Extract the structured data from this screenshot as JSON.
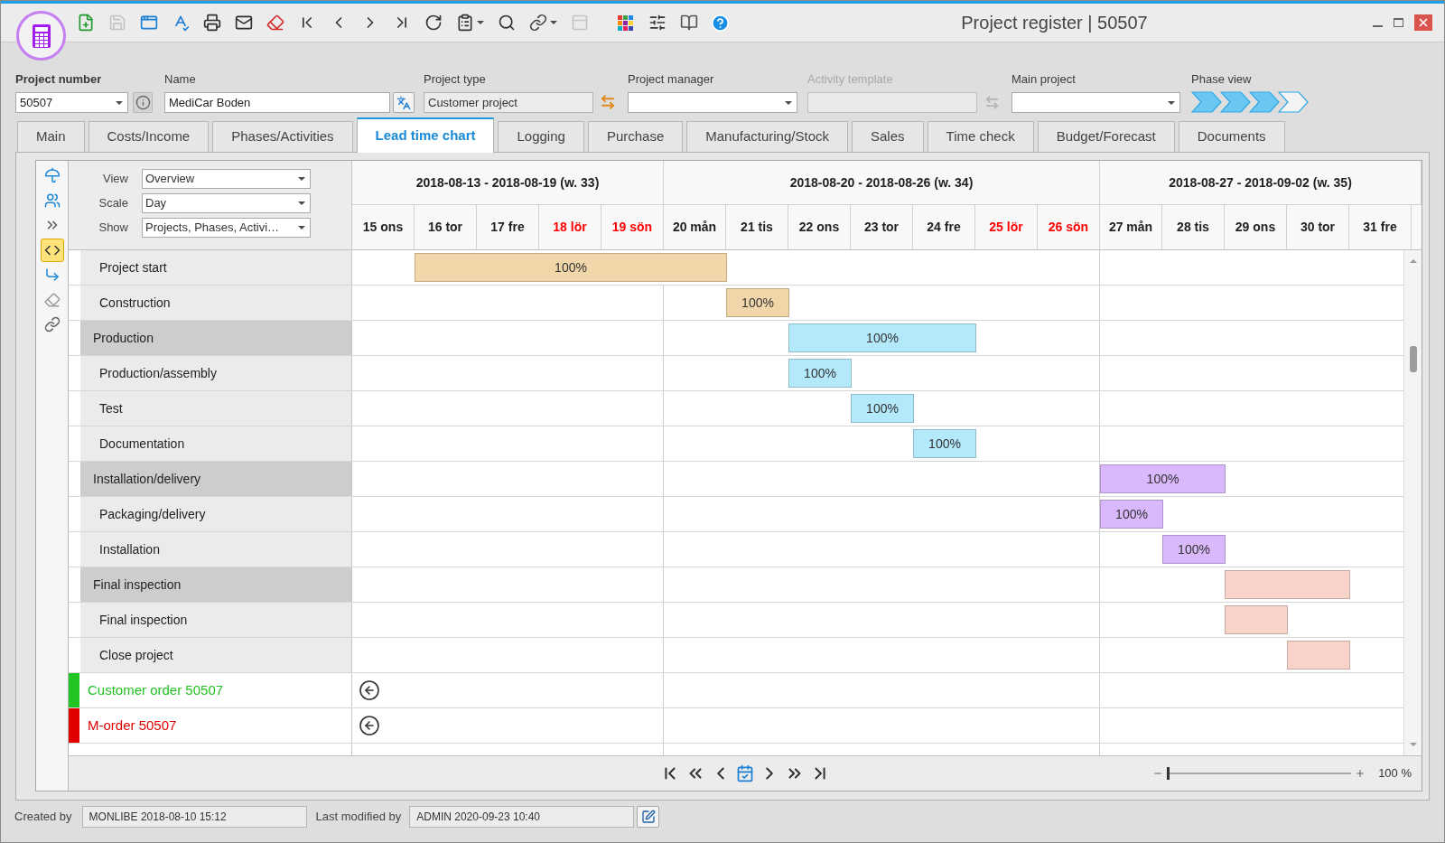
{
  "window": {
    "title": "Project register | 50507"
  },
  "toolbar": [
    {
      "kind": "new",
      "disabled": false,
      "dropdown": false
    },
    {
      "kind": "save",
      "disabled": true,
      "dropdown": false
    },
    {
      "kind": "window",
      "disabled": false,
      "dropdown": false
    },
    {
      "kind": "spell",
      "disabled": false,
      "dropdown": false
    },
    {
      "kind": "print",
      "disabled": false,
      "dropdown": false
    },
    {
      "kind": "mail",
      "disabled": false,
      "dropdown": false
    },
    {
      "kind": "eraser",
      "disabled": false,
      "dropdown": false
    },
    {
      "kind": "first",
      "disabled": false,
      "dropdown": false
    },
    {
      "kind": "prev",
      "disabled": false,
      "dropdown": false
    },
    {
      "kind": "next",
      "disabled": false,
      "dropdown": false
    },
    {
      "kind": "last",
      "disabled": false,
      "dropdown": false
    },
    {
      "kind": "refresh",
      "disabled": false,
      "dropdown": false
    },
    {
      "kind": "clipboard",
      "disabled": false,
      "dropdown": true
    },
    {
      "kind": "search",
      "disabled": false,
      "dropdown": false
    },
    {
      "kind": "link",
      "disabled": false,
      "dropdown": true
    },
    {
      "kind": "panel",
      "disabled": true,
      "dropdown": false
    },
    {
      "kind": "grid",
      "disabled": false,
      "dropdown": false
    },
    {
      "kind": "sliders",
      "disabled": false,
      "dropdown": false
    },
    {
      "kind": "book",
      "disabled": false,
      "dropdown": false
    },
    {
      "kind": "help",
      "disabled": false,
      "dropdown": false
    }
  ],
  "header_fields": {
    "project_number": {
      "label": "Project number",
      "value": "50507"
    },
    "name": {
      "label": "Name",
      "value": "MediCar Boden"
    },
    "project_type": {
      "label": "Project type",
      "value": "Customer project",
      "readonly": true
    },
    "project_manager": {
      "label": "Project manager"
    },
    "activity_template": {
      "label": "Activity template",
      "disabled": true
    },
    "main_project": {
      "label": "Main project"
    },
    "phase_view": {
      "label": "Phase view",
      "phases": [
        {
          "done": true
        },
        {
          "done": true
        },
        {
          "done": true
        },
        {
          "done": false
        }
      ]
    }
  },
  "tabs": [
    {
      "label": "Main",
      "selected": false
    },
    {
      "label": "Costs/Income",
      "selected": false
    },
    {
      "label": "Phases/Activities",
      "selected": false
    },
    {
      "label": "Lead time chart",
      "selected": true
    },
    {
      "label": "Logging",
      "selected": false
    },
    {
      "label": "Purchase",
      "selected": false
    },
    {
      "label": "Manufacturing/Stock",
      "selected": false
    },
    {
      "label": "Sales",
      "selected": false
    },
    {
      "label": "Time check",
      "selected": false
    },
    {
      "label": "Budget/Forecast",
      "selected": false
    },
    {
      "label": "Documents",
      "selected": false
    }
  ],
  "side_tools": [
    {
      "kind": "umbrella",
      "selected": false
    },
    {
      "kind": "people",
      "selected": false
    },
    {
      "kind": "arrows",
      "selected": false
    },
    {
      "kind": "code",
      "selected": true
    },
    {
      "kind": "connector",
      "selected": false
    },
    {
      "kind": "eraser",
      "selected": false
    },
    {
      "kind": "link",
      "selected": false
    }
  ],
  "chart_options": [
    {
      "label": "View",
      "value": "Overview"
    },
    {
      "label": "Scale",
      "value": "Day"
    },
    {
      "label": "Show",
      "value": "Projects, Phases, Activi…"
    }
  ],
  "weeks": [
    {
      "label": "2018-08-13 - 2018-08-19 (w. 33)",
      "days": [
        {
          "label": "15 ons",
          "weekend": false
        },
        {
          "label": "16 tor",
          "weekend": false
        },
        {
          "label": "17 fre",
          "weekend": false
        },
        {
          "label": "18 lör",
          "weekend": true
        },
        {
          "label": "19 sön",
          "weekend": true
        }
      ]
    },
    {
      "label": "2018-08-20 - 2018-08-26 (w. 34)",
      "days": [
        {
          "label": "20 mån",
          "weekend": false
        },
        {
          "label": "21 tis",
          "weekend": false
        },
        {
          "label": "22 ons",
          "weekend": false
        },
        {
          "label": "23 tor",
          "weekend": false
        },
        {
          "label": "24 fre",
          "weekend": false
        },
        {
          "label": "25 lör",
          "weekend": true
        },
        {
          "label": "26 sön",
          "weekend": true
        }
      ]
    },
    {
      "label": "2018-08-27 - 2018-09-02 (w. 35)",
      "days": [
        {
          "label": "27 mån",
          "weekend": false
        },
        {
          "label": "28 tis",
          "weekend": false
        },
        {
          "label": "29 ons",
          "weekend": false
        },
        {
          "label": "30 tor",
          "weekend": false
        },
        {
          "label": "31 fre",
          "weekend": false
        }
      ]
    }
  ],
  "rows": [
    {
      "kind": "activity",
      "label": "Project start",
      "color": "#f1d6a9",
      "bar_label": "100%",
      "scheduled": [
        false,
        true,
        true,
        true,
        true,
        true,
        false,
        false,
        false,
        false,
        false,
        false,
        false,
        false,
        false,
        false,
        false
      ]
    },
    {
      "kind": "activity",
      "label": "Construction",
      "color": "#f1d6a9",
      "bar_label": "100%",
      "scheduled": [
        false,
        false,
        false,
        false,
        false,
        false,
        true,
        false,
        false,
        false,
        false,
        false,
        false,
        false,
        false,
        false,
        false
      ]
    },
    {
      "kind": "phase",
      "label": "Production",
      "color": "#b3e9fb",
      "bar_label": "100%",
      "scheduled": [
        false,
        false,
        false,
        false,
        false,
        false,
        false,
        true,
        true,
        true,
        false,
        false,
        false,
        false,
        false,
        false,
        false
      ]
    },
    {
      "kind": "activity",
      "label": "Production/assembly",
      "color": "#b3e9fb",
      "bar_label": "100%",
      "scheduled": [
        false,
        false,
        false,
        false,
        false,
        false,
        false,
        true,
        false,
        false,
        false,
        false,
        false,
        false,
        false,
        false,
        false
      ]
    },
    {
      "kind": "activity",
      "label": "Test",
      "color": "#b3e9fb",
      "bar_label": "100%",
      "scheduled": [
        false,
        false,
        false,
        false,
        false,
        false,
        false,
        false,
        true,
        false,
        false,
        false,
        false,
        false,
        false,
        false,
        false
      ]
    },
    {
      "kind": "activity",
      "label": "Documentation",
      "color": "#b3e9fb",
      "bar_label": "100%",
      "scheduled": [
        false,
        false,
        false,
        false,
        false,
        false,
        false,
        false,
        false,
        true,
        false,
        false,
        false,
        false,
        false,
        false,
        false
      ]
    },
    {
      "kind": "phase",
      "label": "Installation/delivery",
      "color": "#d9b8fb",
      "bar_label": "100%",
      "scheduled": [
        false,
        false,
        false,
        false,
        false,
        false,
        false,
        false,
        false,
        false,
        false,
        false,
        true,
        true,
        false,
        false,
        false
      ]
    },
    {
      "kind": "activity",
      "label": "Packaging/delivery",
      "color": "#d9b8fb",
      "bar_label": "100%",
      "scheduled": [
        false,
        false,
        false,
        false,
        false,
        false,
        false,
        false,
        false,
        false,
        false,
        false,
        true,
        false,
        false,
        false,
        false
      ]
    },
    {
      "kind": "activity",
      "label": "Installation",
      "color": "#d9b8fb",
      "bar_label": "100%",
      "scheduled": [
        false,
        false,
        false,
        false,
        false,
        false,
        false,
        false,
        false,
        false,
        false,
        false,
        false,
        true,
        false,
        false,
        false
      ]
    },
    {
      "kind": "phase",
      "label": "Final inspection",
      "color": "#f7d3ca",
      "scheduled": [
        false,
        false,
        false,
        false,
        false,
        false,
        false,
        false,
        false,
        false,
        false,
        false,
        false,
        false,
        true,
        true,
        false
      ]
    },
    {
      "kind": "activity",
      "label": "Final inspection",
      "color": "#f7d3ca",
      "scheduled": [
        false,
        false,
        false,
        false,
        false,
        false,
        false,
        false,
        false,
        false,
        false,
        false,
        false,
        false,
        true,
        false,
        false
      ]
    },
    {
      "kind": "activity",
      "label": "Close project",
      "color": "#f7d3ca",
      "scheduled": [
        false,
        false,
        false,
        false,
        false,
        false,
        false,
        false,
        false,
        false,
        false,
        false,
        false,
        false,
        false,
        true,
        false
      ]
    },
    {
      "kind": "order",
      "label": "Customer order 50507",
      "color": "#22c322"
    },
    {
      "kind": "order",
      "label": "M-order 50507",
      "color": "#e00000"
    }
  ],
  "navigator": {
    "zoom": {
      "level": 0,
      "reading": "100 %"
    }
  },
  "footer": {
    "created": {
      "label": "Created by",
      "value": "MONLIBE 2018-08-10 15:12"
    },
    "modified": {
      "label": "Last modified by",
      "value": "ADMIN 2020-09-23 10:40"
    }
  }
}
